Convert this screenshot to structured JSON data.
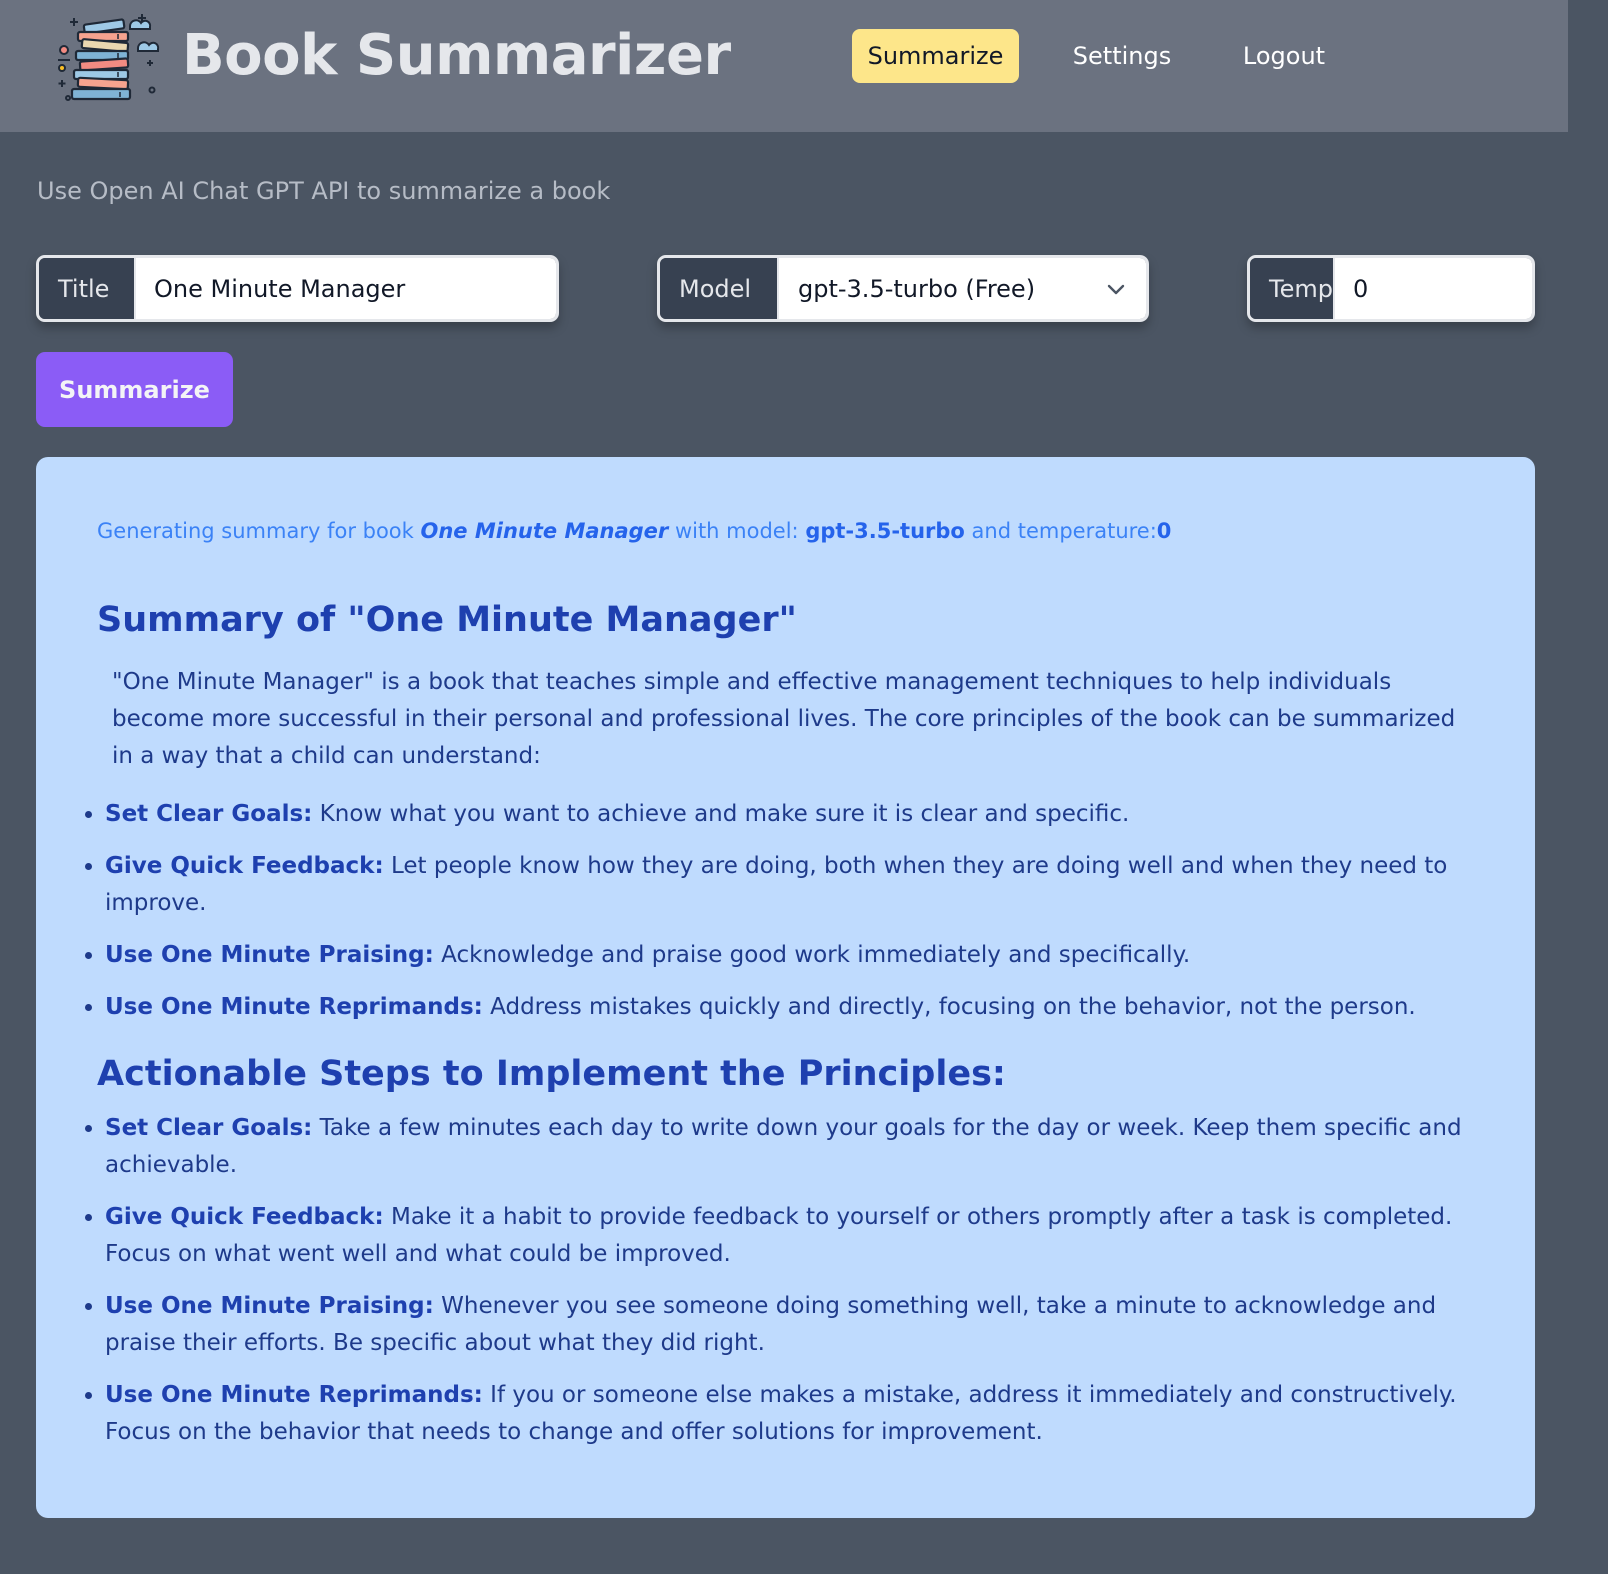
{
  "header": {
    "app_title": "Book Summarizer",
    "nav": [
      {
        "label": "Summarize",
        "active": true
      },
      {
        "label": "Settings",
        "active": false
      },
      {
        "label": "Logout",
        "active": false
      }
    ],
    "active_color": "#fde68a"
  },
  "main": {
    "subtitle": "Use Open AI Chat GPT API to summarize a book",
    "title_field": {
      "label": "Title",
      "value": "One Minute Manager"
    },
    "model_field": {
      "label": "Model",
      "value": "gpt-3.5-turbo (Free)"
    },
    "temp_field": {
      "label": "Temp",
      "value": "0"
    },
    "summarize_button": "Summarize",
    "accent_color": "#8b5cf6"
  },
  "result": {
    "status": {
      "prefix": "Generating summary for book ",
      "book": "One Minute Manager",
      "mid": " with model: ",
      "model": "gpt-3.5-turbo",
      "suffix": " and temperature:",
      "temperature": "0"
    },
    "summary_heading": "Summary of \"One Minute Manager\"",
    "intro": "\"One Minute Manager\" is a book that teaches simple and effective management techniques to help individuals become more successful in their personal and professional lives. The core principles of the book can be summarized in a way that a child can understand:",
    "principles": [
      {
        "term": "Set Clear Goals:",
        "text": " Know what you want to achieve and make sure it is clear and specific."
      },
      {
        "term": "Give Quick Feedback:",
        "text": " Let people know how they are doing, both when they are doing well and when they need to improve."
      },
      {
        "term": "Use One Minute Praising:",
        "text": " Acknowledge and praise good work immediately and specifically."
      },
      {
        "term": "Use One Minute Reprimands:",
        "text": " Address mistakes quickly and directly, focusing on the behavior, not the person."
      }
    ],
    "steps_heading": "Actionable Steps to Implement the Principles:",
    "steps": [
      {
        "term": "Set Clear Goals:",
        "text": " Take a few minutes each day to write down your goals for the day or week. Keep them specific and achievable."
      },
      {
        "term": "Give Quick Feedback:",
        "text": " Make it a habit to provide feedback to yourself or others promptly after a task is completed. Focus on what went well and what could be improved."
      },
      {
        "term": "Use One Minute Praising:",
        "text": " Whenever you see someone doing something well, take a minute to acknowledge and praise their efforts. Be specific about what they did right."
      },
      {
        "term": "Use One Minute Reprimands:",
        "text": " If you or someone else makes a mistake, address it immediately and constructively. Focus on the behavior that needs to change and offer solutions for improvement."
      }
    ]
  },
  "icons": {
    "logo": "stacked-books-icon",
    "dropdown": "chevron-down-icon"
  }
}
